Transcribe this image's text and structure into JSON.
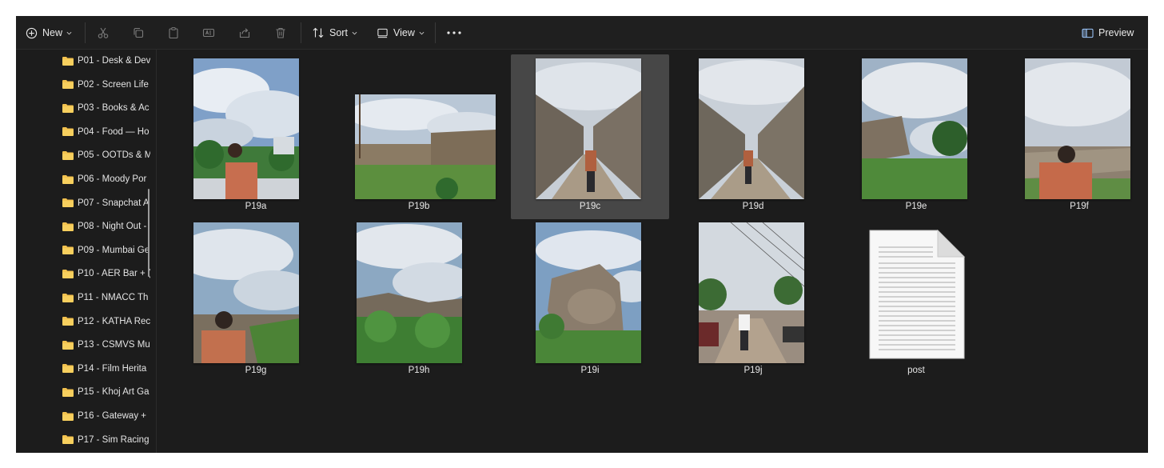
{
  "toolbar": {
    "new_label": "New",
    "sort_label": "Sort",
    "view_label": "View",
    "preview_label": "Preview"
  },
  "colors": {
    "background": "#1c1c1c",
    "folder": "#f2c14e",
    "selection": "#474747"
  },
  "sidebar": {
    "items": [
      {
        "label": "P01 - Desk & Dev"
      },
      {
        "label": "P02 - Screen Life"
      },
      {
        "label": "P03 - Books & Ac"
      },
      {
        "label": "P04 - Food — Ho"
      },
      {
        "label": "P05 - OOTDs & M"
      },
      {
        "label": "P06 - Moody Por"
      },
      {
        "label": "P07 - Snapchat A"
      },
      {
        "label": "P08 - Night Out -"
      },
      {
        "label": "P09 - Mumbai Ge"
      },
      {
        "label": "P10 - AER Bar + ("
      },
      {
        "label": "P11 - NMACC Th"
      },
      {
        "label": "P12 - KATHA Rec"
      },
      {
        "label": "P13 - CSMVS Mu"
      },
      {
        "label": "P14 - Film Herita"
      },
      {
        "label": "P15 - Khoj Art Ga"
      },
      {
        "label": "P16 - Gateway +"
      },
      {
        "label": "P17 - Sim Racing"
      }
    ]
  },
  "files": [
    {
      "name": "P19a",
      "type": "image"
    },
    {
      "name": "P19b",
      "type": "image"
    },
    {
      "name": "P19c",
      "type": "image",
      "selected": true
    },
    {
      "name": "P19d",
      "type": "image"
    },
    {
      "name": "P19e",
      "type": "image"
    },
    {
      "name": "P19f",
      "type": "image"
    },
    {
      "name": "P19g",
      "type": "image"
    },
    {
      "name": "P19h",
      "type": "image"
    },
    {
      "name": "P19i",
      "type": "image"
    },
    {
      "name": "P19j",
      "type": "image"
    },
    {
      "name": "post",
      "type": "text-document"
    }
  ]
}
